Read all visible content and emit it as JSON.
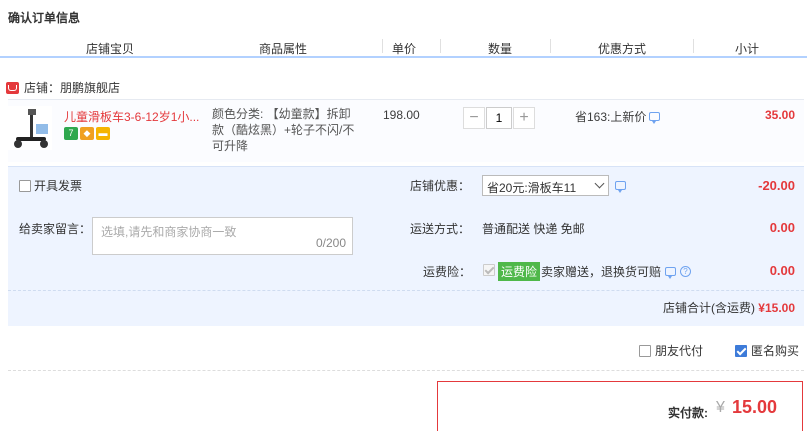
{
  "page_title": "确认订单信息",
  "columns": [
    "店铺宝贝",
    "商品属性",
    "单价",
    "数量",
    "优惠方式",
    "小计"
  ],
  "shop": {
    "label": "店铺：",
    "name": "朋鹏旗舰店"
  },
  "item": {
    "title": "儿童滑板车3-6-12岁1小...",
    "props": "颜色分类: 【幼童款】拆卸款（酷炫黑）+轮子不闪/不可升降",
    "price": "198.00",
    "quantity": "1",
    "promo": "省163:上新价",
    "subtotal": "35.00",
    "tag_colors": [
      "#2fa84f",
      "#f0a020",
      "#f5b400"
    ]
  },
  "invoice": {
    "label": "开具发票"
  },
  "message": {
    "label": "给卖家留言：",
    "placeholder": "选填,请先和商家协商一致",
    "count": "0/200"
  },
  "shop_discount": {
    "label": "店铺优惠：",
    "selected": "省20元:滑板车11",
    "amount": "-20.00"
  },
  "shipping": {
    "label": "运送方式：",
    "value": "普通配送 快递 免邮",
    "amount": "0.00"
  },
  "insurance": {
    "label": "运费险：",
    "badge": "运费险",
    "value": "卖家赠送，退换货可赔",
    "amount": "0.00"
  },
  "shop_total": {
    "label": "店铺合计(含运费)",
    "amount": "¥15.00"
  },
  "options": {
    "friend_pay": "朋友代付",
    "anonymous": "匿名购买"
  },
  "payment": {
    "label": "实付款:",
    "symbol": "¥",
    "amount": "15.00"
  },
  "colors": {
    "accent": "#e4393c",
    "panel_bg": "#eef4ff",
    "header_line": "#b2d1ff",
    "link_blue": "#3d7bd9",
    "badge_green": "#4fb84a"
  }
}
